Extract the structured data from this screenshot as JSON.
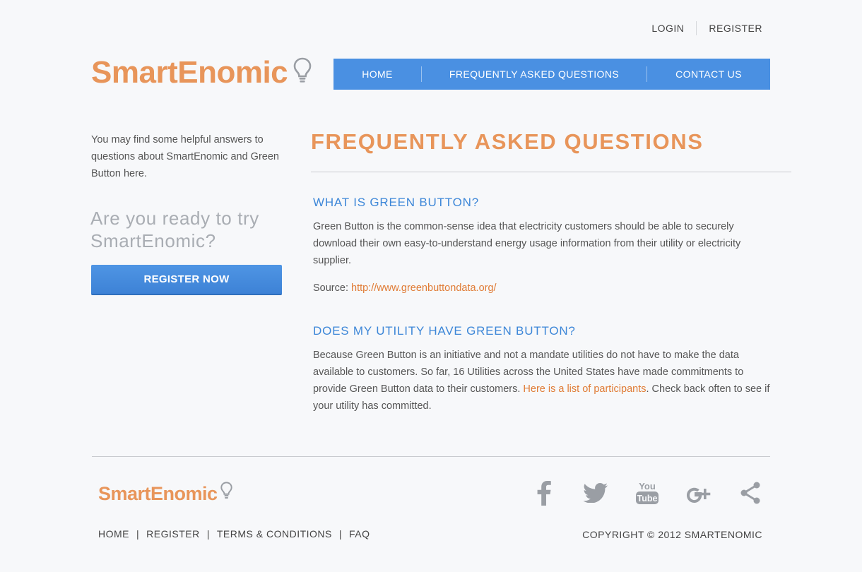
{
  "top_links": {
    "login": "LOGIN",
    "register": "REGISTER"
  },
  "logo": {
    "text": "SmartEnomic"
  },
  "nav": {
    "home": "HOME",
    "faq": "FREQUENTLY ASKED QUESTIONS",
    "contact": "CONTACT US"
  },
  "sidebar": {
    "intro": "You may find some helpful answers to questions about SmartEnomic and Green Button here.",
    "cta": "Are you ready to try SmartEnomic?",
    "register_button": "REGISTER NOW"
  },
  "main": {
    "title": "FREQUENTLY ASKED QUESTIONS",
    "questions": [
      {
        "heading": "WHAT IS GREEN BUTTON?",
        "answer": "Green Button is the common-sense idea that electricity customers should be able to securely download their own easy-to-understand energy usage information from their utility or electricity supplier.",
        "source_label": "Source: ",
        "source_link": "http://www.greenbuttondata.org/"
      },
      {
        "heading": "DOES MY UTILITY HAVE GREEN BUTTON?",
        "answer_before": "Because Green Button is an initiative and not a mandate utilities do not have to make the data available to customers. So far, 16 Utilities across the United States have made commitments to provide Green Button data to their customers. ",
        "answer_link": "Here is a list of participants",
        "answer_after": ". Check back often to see if your utility has committed."
      }
    ]
  },
  "footer": {
    "links": [
      "HOME",
      "REGISTER",
      "TERMS & CONDITIONS",
      "FAQ"
    ],
    "copyright": "COPYRIGHT © 2012 SMARTENOMIC",
    "social_icons": [
      "facebook-icon",
      "twitter-icon",
      "youtube-icon",
      "google-plus-icon",
      "share-icon"
    ],
    "youtube_text_top": "You",
    "youtube_text_bottom": "Tube"
  },
  "colors": {
    "accent_orange": "#e8955a",
    "nav_blue": "#4a90e2",
    "heading_blue": "#3d87d8",
    "link_orange": "#e07b35",
    "icon_gray": "#9a9ea4"
  }
}
